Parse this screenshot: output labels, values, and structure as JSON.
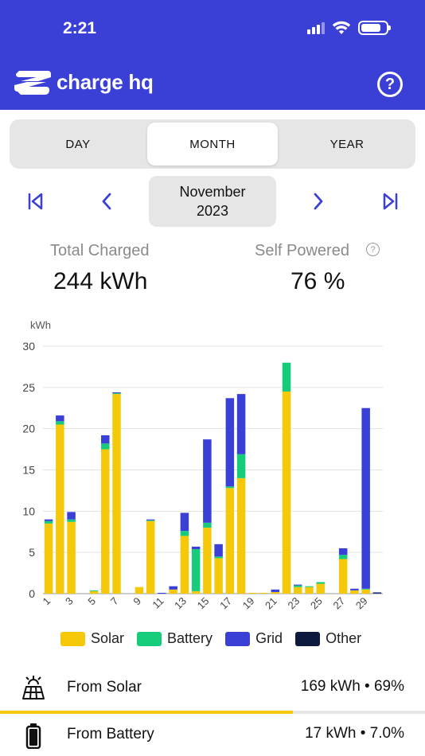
{
  "status_bar": {
    "time": "2:21"
  },
  "header": {
    "brand": "charge hq",
    "help_icon": "question-circle-icon",
    "background": "#3a3fd6"
  },
  "tabs": [
    {
      "label": "DAY",
      "active": false
    },
    {
      "label": "MONTH",
      "active": true
    },
    {
      "label": "YEAR",
      "active": false
    }
  ],
  "period": {
    "month": "November",
    "year": "2023"
  },
  "stats": {
    "total_label": "Total Charged",
    "total_value": "244 kWh",
    "self_label": "Self Powered",
    "self_value": "76 %"
  },
  "legend": [
    {
      "name": "Solar",
      "color": "#f5c80a"
    },
    {
      "name": "Battery",
      "color": "#14cc7a"
    },
    {
      "name": "Grid",
      "color": "#3a3fd6"
    },
    {
      "name": "Other",
      "color": "#0d1a3d"
    }
  ],
  "chart_data": {
    "type": "bar",
    "stacked": true,
    "ylabel": "kWh",
    "ylim": [
      0,
      30
    ],
    "yticks": [
      0,
      5,
      10,
      15,
      20,
      25,
      30
    ],
    "categories": [
      "1",
      "2",
      "3",
      "4",
      "5",
      "6",
      "7",
      "8",
      "9",
      "10",
      "11",
      "12",
      "13",
      "14",
      "15",
      "16",
      "17",
      "18",
      "19",
      "20",
      "21",
      "22",
      "23",
      "24",
      "25",
      "26",
      "27",
      "28",
      "29",
      "30"
    ],
    "xtick_labels": [
      "1",
      "3",
      "5",
      "7",
      "9",
      "11",
      "13",
      "15",
      "17",
      "19",
      "21",
      "23",
      "25",
      "27",
      "29"
    ],
    "grid": true,
    "series": [
      {
        "name": "Solar",
        "color": "#f5c80a",
        "values": [
          8.5,
          20.5,
          8.7,
          0,
          0.3,
          17.5,
          24.2,
          0,
          0.8,
          8.8,
          0,
          0.5,
          7.0,
          0.3,
          8.0,
          4.3,
          12.8,
          14.0,
          0.1,
          0.1,
          0.2,
          24.5,
          0.8,
          0.8,
          1.2,
          0,
          4.2,
          0.4,
          0.5,
          0
        ]
      },
      {
        "name": "Battery",
        "color": "#14cc7a",
        "values": [
          0.3,
          0.4,
          0.3,
          0,
          0.1,
          0.7,
          0.1,
          0,
          0,
          0.1,
          0,
          0,
          0.6,
          5.1,
          0.6,
          0.2,
          0.2,
          2.9,
          0,
          0,
          0,
          3.5,
          0.2,
          0.1,
          0.2,
          0,
          0.5,
          0,
          0.1,
          0
        ]
      },
      {
        "name": "Grid",
        "color": "#3a3fd6",
        "values": [
          0.2,
          0.7,
          0.9,
          0,
          0,
          1.0,
          0.1,
          0,
          0,
          0.1,
          0.1,
          0.4,
          2.2,
          0.3,
          10.1,
          1.5,
          10.7,
          7.3,
          0,
          0,
          0.3,
          0,
          0.1,
          0,
          0,
          0,
          0.8,
          0.2,
          21.9,
          0.1
        ]
      },
      {
        "name": "Other",
        "color": "#0d1a3d",
        "values": [
          0,
          0,
          0,
          0,
          0,
          0,
          0,
          0,
          0,
          0,
          0,
          0,
          0,
          0,
          0,
          0,
          0,
          0,
          0,
          0,
          0,
          0,
          0,
          0,
          0,
          0,
          0,
          0,
          0,
          0.05
        ]
      }
    ]
  },
  "sources": [
    {
      "label": "From Solar",
      "value": "169 kWh • 69%",
      "fraction": 0.69,
      "icon": "solar-panel-icon"
    },
    {
      "label": "From Battery",
      "value": "17 kWh • 7.0%",
      "fraction": 0.07,
      "icon": "battery-icon"
    }
  ]
}
